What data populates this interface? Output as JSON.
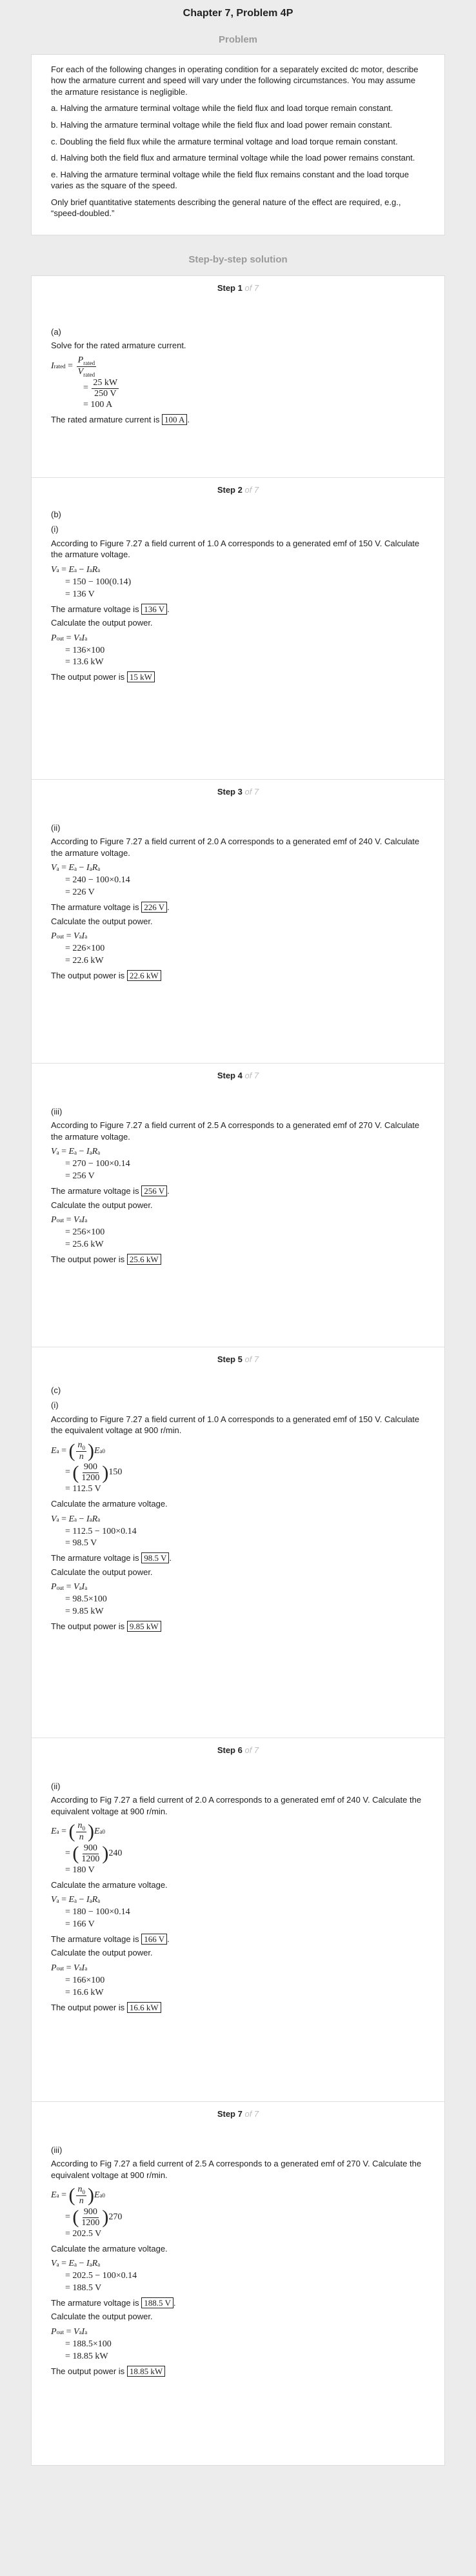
{
  "header": {
    "chapter_title": "Chapter 7, Problem 4P",
    "problem_heading": "Problem",
    "solution_heading": "Step-by-step solution"
  },
  "problem": {
    "intro": "For each of the following changes in operating condition for a separately excited dc motor, describe how the armature current and speed will vary under the following circumstances. You may assume the armature resistance is negligible.",
    "a": "a. Halving the armature terminal voltage while the field flux and load torque remain constant.",
    "b": "b. Halving the armature terminal voltage while the field flux and load power remain constant.",
    "c": "c. Doubling the field flux while the armature terminal voltage and load torque remain constant.",
    "d": "d. Halving both the field flux and armature terminal voltage while the load power remains constant.",
    "e": "e. Halving the armature terminal voltage while the field flux remains constant and the load torque varies as the square of the speed.",
    "note": "Only brief quantitative statements describing the general nature of the effect are required, e.g., “speed-doubled.”"
  },
  "steps": {
    "of_label": "of 7",
    "s1": {
      "title": "Step 1",
      "part": "(a)",
      "text": "Solve for the rated armature current.",
      "lhs": "I",
      "lhs_sub": "rated",
      "p_num": "P",
      "p_num_sub": "rated",
      "p_den": "V",
      "p_den_sub": "rated",
      "frac_num": "25 kW",
      "frac_den": "250 V",
      "result": "= 100 A",
      "conclusion": "The rated armature current is",
      "answer": "100 A"
    },
    "s2": {
      "title": "Step 2",
      "part": "(b)",
      "sub": "(i)",
      "text": "According to Figure 7.27 a field current of 1.0 A corresponds to a generated emf of 150 V. Calculate the armature voltage.",
      "eq1": "= 150 − 100(0.14)",
      "eq2": "= 136 V",
      "va_text": "The armature voltage is",
      "va_answer": "136 V",
      "power_text": "Calculate the output power.",
      "p1": "= 136×100",
      "p2": "= 13.6 kW",
      "po_text": "The output power is",
      "po_answer": "15 kW"
    },
    "s3": {
      "title": "Step 3",
      "sub": "(ii)",
      "text": "According to Figure 7.27 a field current of 2.0 A corresponds to a generated emf of 240 V. Calculate the armature voltage.",
      "eq1": "= 240 − 100×0.14",
      "eq2": "= 226 V",
      "va_text": "The armature voltage is",
      "va_answer": "226 V",
      "power_text": "Calculate the output power.",
      "p1": "= 226×100",
      "p2": "= 22.6 kW",
      "po_text": "The output power is",
      "po_answer": "22.6 kW"
    },
    "s4": {
      "title": "Step 4",
      "sub": "(iii)",
      "text": "According to Figure 7.27 a field current of 2.5 A corresponds to a generated emf of 270 V. Calculate the armature voltage.",
      "eq1": "= 270 − 100×0.14",
      "eq2": "= 256 V",
      "va_text": "The armature voltage is",
      "va_answer": "256 V",
      "power_text": "Calculate the output power.",
      "p1": "= 256×100",
      "p2": "= 25.6 kW",
      "po_text": "The output power is",
      "po_answer": "25.6 kW"
    },
    "s5": {
      "title": "Step 5",
      "part": "(c)",
      "sub": "(i)",
      "text": "According to Figure 7.27 a field current of 1.0 A corresponds to a generated emf of 150 V. Calculate the equivalent voltage at 900 r/min.",
      "ratio_num": "900",
      "ratio_den": "1200",
      "emf": "150",
      "ea_result": "= 112.5 V",
      "arm_text": "Calculate the armature voltage.",
      "eq1": "= 112.5 − 100×0.14",
      "eq2": "= 98.5 V",
      "va_text": "The armature voltage is",
      "va_answer": "98.5 V",
      "power_text": "Calculate the output power.",
      "p1": "= 98.5×100",
      "p2": "= 9.85 kW",
      "po_text": "The output power is",
      "po_answer": "9.85 kW"
    },
    "s6": {
      "title": "Step 6",
      "sub": "(ii)",
      "text": "According to Fig 7.27 a field current of 2.0 A corresponds to a generated emf of 240 V. Calculate the equivalent voltage at 900 r/min.",
      "ratio_num": "900",
      "ratio_den": "1200",
      "emf": "240",
      "ea_result": "= 180 V",
      "arm_text": "Calculate the armature voltage.",
      "eq1": "= 180 − 100×0.14",
      "eq2": "= 166 V",
      "va_text": "The armature voltage is",
      "va_answer": "166 V",
      "power_text": "Calculate the output power.",
      "p1": "= 166×100",
      "p2": "= 16.6 kW",
      "po_text": "The output power is",
      "po_answer": "16.6 kW"
    },
    "s7": {
      "title": "Step 7",
      "sub": "(iii)",
      "text": "According to Fig 7.27 a field current of 2.5 A corresponds to a generated emf of 270 V. Calculate the equivalent voltage at 900 r/min.",
      "ratio_num": "900",
      "ratio_den": "1200",
      "emf": "270",
      "ea_result": "= 202.5 V",
      "arm_text": "Calculate the armature voltage.",
      "eq1": "= 202.5 − 100×0.14",
      "eq2": "= 188.5 V",
      "va_text": "The armature voltage is",
      "va_answer": "188.5 V",
      "power_text": "Calculate the output power.",
      "p1": "= 188.5×100",
      "p2": "= 18.85 kW",
      "po_text": "The output power is",
      "po_answer": "18.85 kW"
    }
  }
}
